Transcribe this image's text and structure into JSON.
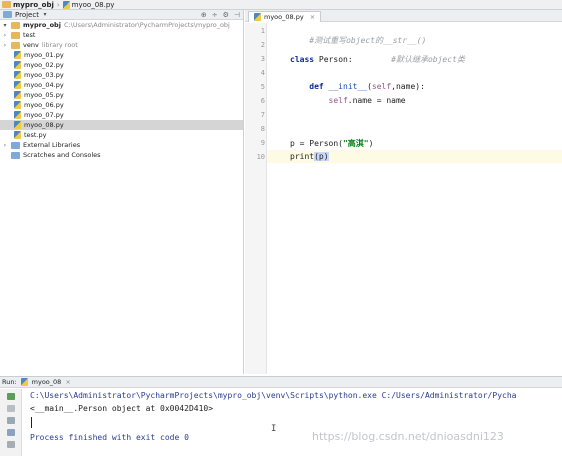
{
  "breadcrumb": {
    "project": "mypro_obj",
    "file": "myoo_08.py"
  },
  "project_panel": {
    "title": "Project",
    "root_name": "mypro_obj",
    "root_path": "C:\\Users\\Administrator\\PycharmProjects\\mypro_obj",
    "folders": [
      {
        "name": "test",
        "note": ""
      },
      {
        "name": "venv",
        "note": "library root"
      }
    ],
    "files": [
      "myoo_01.py",
      "myoo_02.py",
      "myoo_03.py",
      "myoo_04.py",
      "myoo_05.py",
      "myoo_06.py",
      "myoo_07.py",
      "myoo_08.py",
      "test.py"
    ],
    "selected_file": "myoo_08.py",
    "external": "External Libraries",
    "scratches": "Scratches and Consoles"
  },
  "editor": {
    "tab": "myoo_08.py",
    "line_numbers": [
      "1",
      "2",
      "3",
      "4",
      "5",
      "6",
      "7",
      "8",
      "9",
      "10"
    ],
    "code": {
      "l1_comment": "#测试重写object的__str__()",
      "l3_kw": "class",
      "l3_name": "Person:",
      "l3_comment": "#默认继承object类",
      "l5_kw": "def",
      "l5_fn": "__init__",
      "l5_paren": "(",
      "l5_self": "self",
      "l5_rest": ",name):",
      "l6_self": "self",
      "l6_rest": ".name = name",
      "l9_pre": "p = Person(",
      "l9_str": "\"高淇\"",
      "l9_post": ")",
      "l10_pre": "print",
      "l10_arg": "(p)"
    }
  },
  "run_panel": {
    "label": "Run:",
    "config": "myoo_08",
    "command": "C:\\Users\\Administrator\\PycharmProjects\\mypro_obj\\venv\\Scripts\\python.exe C:/Users/Administrator/Pycha",
    "output": "<__main__.Person object at 0x0042D410>",
    "finished": "Process finished with exit code 0"
  },
  "watermark": "https://blog.csdn.net/dnioasdni123"
}
